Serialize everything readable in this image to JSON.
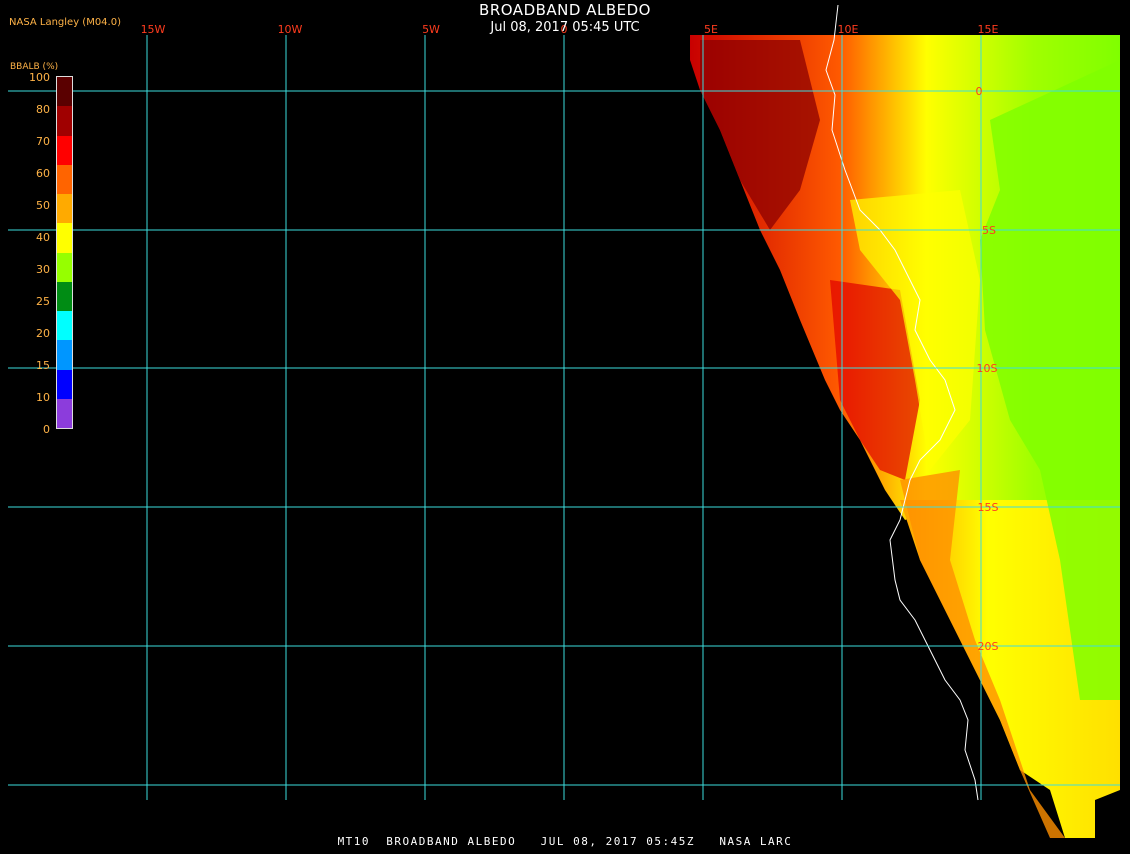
{
  "header": {
    "provider": "NASA Langley (M04.0)",
    "title": "BROADBAND ALBEDO",
    "date": "Jul 08, 2017 05:45 UTC"
  },
  "legend": {
    "label": "BBALB (%)",
    "ticks": [
      "100",
      "80",
      "70",
      "60",
      "50",
      "40",
      "30",
      "25",
      "20",
      "15",
      "10",
      "0"
    ],
    "colors": [
      "#5a0000",
      "#a00000",
      "#ff0000",
      "#ff6400",
      "#ffaa00",
      "#ffff00",
      "#96ff00",
      "#008c14",
      "#00ffff",
      "#0096ff",
      "#0000ff",
      "#8c3cdc"
    ]
  },
  "grid": {
    "lon_labels": [
      "15W",
      "10W",
      "5W",
      "0",
      "5E",
      "10E",
      "15E"
    ],
    "lat_labels": [
      "0",
      "5S",
      "10S",
      "15S",
      "20S"
    ],
    "line_color": "#3cdcdc",
    "label_color": "#ff3c1e"
  },
  "footer": {
    "text": "MT10  BROADBAND ALBEDO   JUL 08, 2017 05:45Z   NASA LARC"
  }
}
